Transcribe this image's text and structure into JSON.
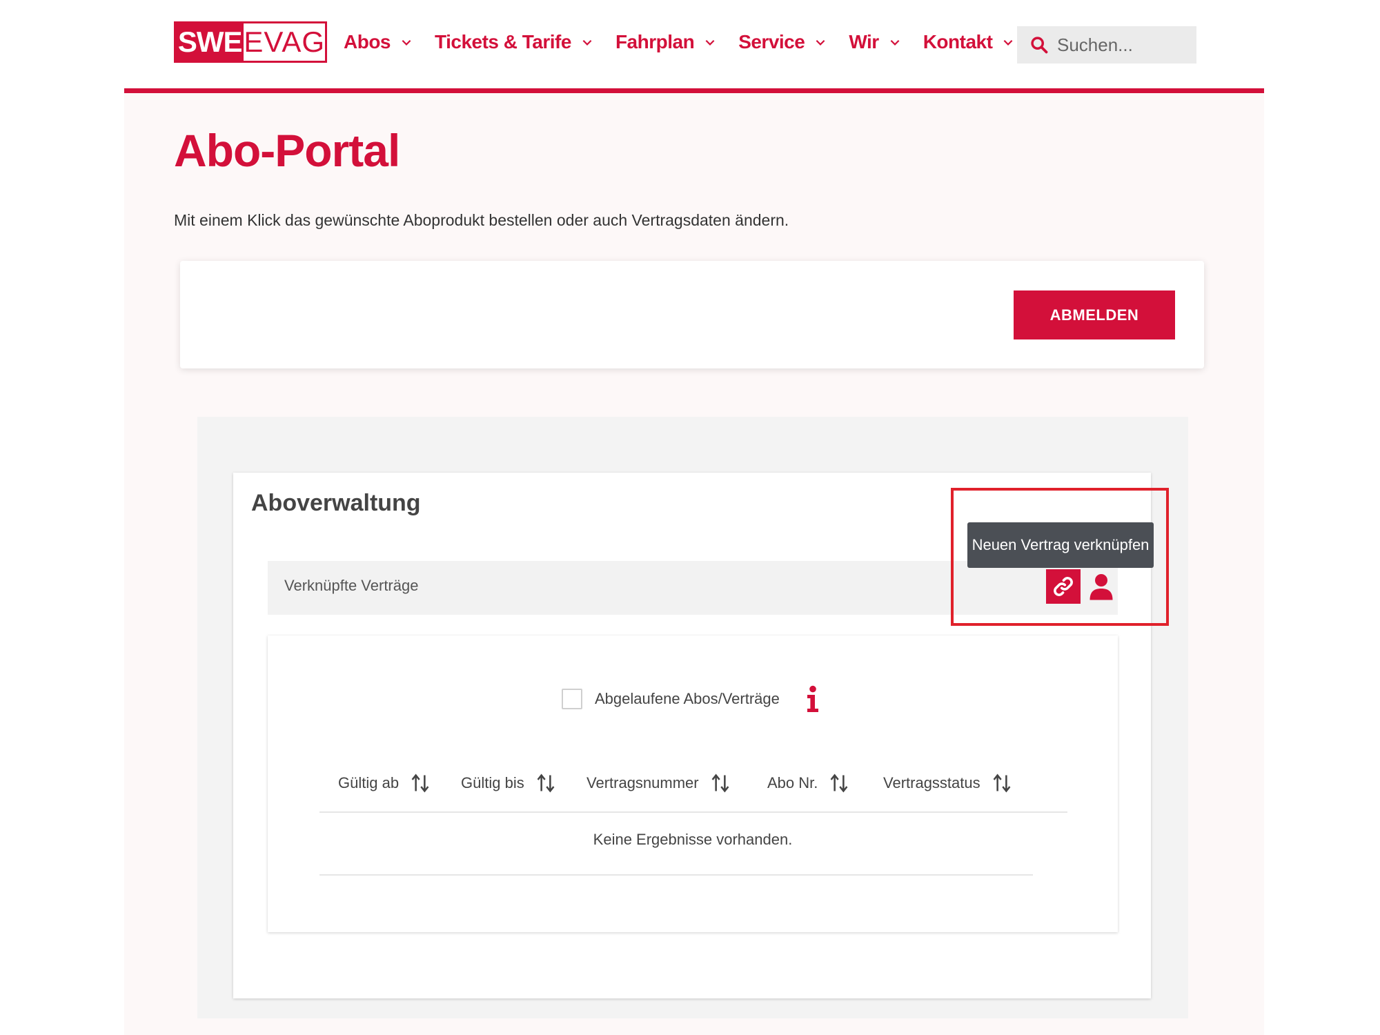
{
  "brand": {
    "logo_left": "SWE",
    "logo_right": "EVAG",
    "accent": "#d3103a"
  },
  "nav": {
    "items": [
      {
        "label": "Abos"
      },
      {
        "label": "Tickets & Tarife"
      },
      {
        "label": "Fahrplan"
      },
      {
        "label": "Service"
      },
      {
        "label": "Wir"
      },
      {
        "label": "Kontakt"
      }
    ]
  },
  "search": {
    "placeholder": "Suchen...",
    "icon": "search-icon"
  },
  "page": {
    "title": "Abo-Portal",
    "intro": "Mit einem Klick das gewünschte Aboprodukt bestellen oder auch Vertragsdaten ändern."
  },
  "login_card": {
    "logout_label": "ABMELDEN"
  },
  "abo": {
    "title": "Aboverwaltung",
    "contracts_label": "Verknüpfte Verträge",
    "tooltip": "Neuen Vertrag verknüpfen",
    "link_icon": "link-icon",
    "user_icon": "user-icon",
    "expired_label": "Abgelaufene Abos/Verträge",
    "columns": [
      {
        "label": "Gültig ab"
      },
      {
        "label": "Gültig bis"
      },
      {
        "label": "Vertragsnummer"
      },
      {
        "label": "Abo Nr."
      },
      {
        "label": "Vertragsstatus"
      }
    ],
    "empty_message": "Keine Ergebnisse vorhanden."
  }
}
